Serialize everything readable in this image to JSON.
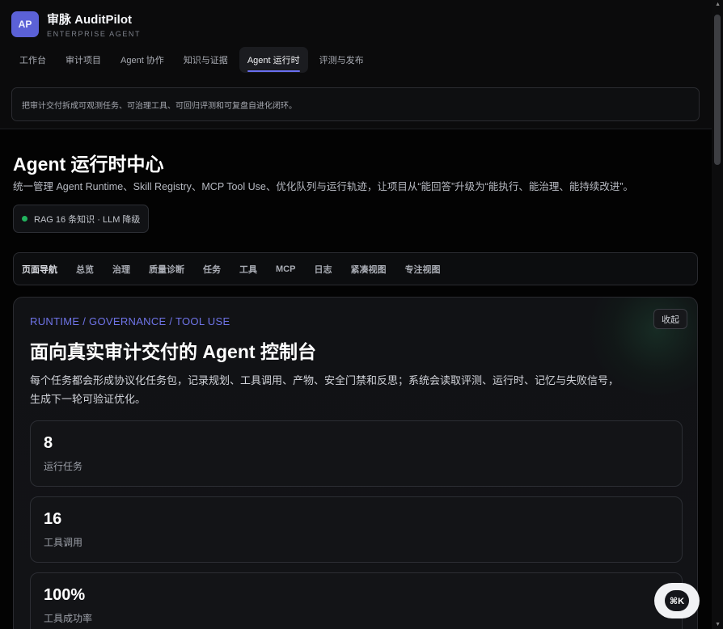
{
  "brand": {
    "logo": "AP",
    "title": "审脉 AuditPilot",
    "subtitle": "ENTERPRISE AGENT"
  },
  "nav": [
    {
      "label": "工作台",
      "active": false
    },
    {
      "label": "审计项目",
      "active": false
    },
    {
      "label": "Agent 协作",
      "active": false
    },
    {
      "label": "知识与证据",
      "active": false
    },
    {
      "label": "Agent 运行时",
      "active": true
    },
    {
      "label": "评测与发布",
      "active": false
    }
  ],
  "notice": "把审计交付拆成可观测任务、可治理工具、可回归评测和可复盘自进化闭环。",
  "page": {
    "title": "Agent 运行时中心",
    "description": "统一管理 Agent Runtime、Skill Registry、MCP Tool Use、优化队列与运行轨迹，让项目从“能回答”升级为“能执行、能治理、能持续改进”。",
    "status_badge": "RAG 16 条知识 · LLM 降级",
    "status_color": "#22b35e"
  },
  "page_nav": {
    "lead": "页面导航",
    "items": [
      "总览",
      "治理",
      "质量诊断",
      "任务",
      "工具",
      "MCP",
      "日志",
      "紧凑视图",
      "专注视图"
    ]
  },
  "panel": {
    "eyebrow": "RUNTIME / GOVERNANCE / TOOL USE",
    "collapse_label": "收起",
    "title": "面向真实审计交付的 Agent 控制台",
    "description": "每个任务都会形成协议化任务包，记录规划、工具调用、产物、安全门禁和反思；系统会读取评测、运行时、记忆与失败信号，生成下一轮可验证优化。",
    "stats": [
      {
        "value": "8",
        "label": "运行任务"
      },
      {
        "value": "16",
        "label": "工具调用"
      },
      {
        "value": "100%",
        "label": "工具成功率"
      }
    ]
  },
  "command_button": "⌘K",
  "accent_color": "#6a6ff0"
}
